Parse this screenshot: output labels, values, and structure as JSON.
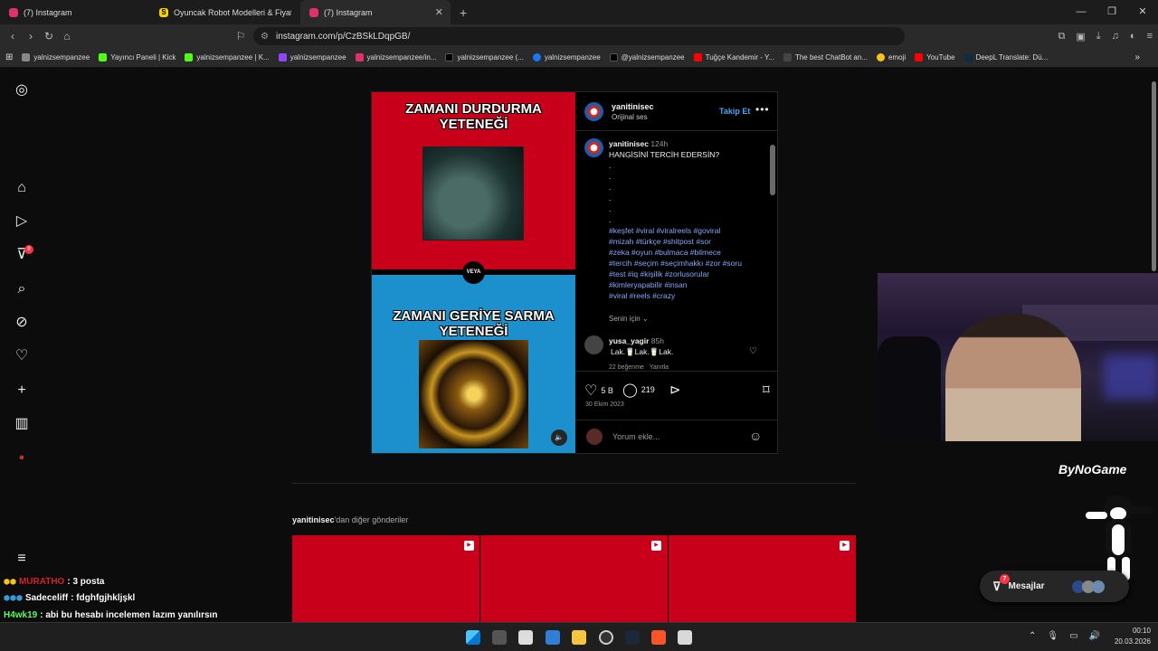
{
  "browser": {
    "tabs": [
      {
        "title": "(7) Instagram",
        "favicon_color": "#e1306c",
        "active": false
      },
      {
        "title": "Oyuncak Robot Modelleri & Fiyatları",
        "favicon_color": "#f7d600",
        "active": false
      },
      {
        "title": "(7) Instagram",
        "favicon_color": "#e1306c",
        "active": true
      }
    ],
    "url": "instagram.com/p/CzBSkLDqpGB/",
    "bookmarks": [
      {
        "label": "yalnizsempanzee",
        "color": "#888"
      },
      {
        "label": "Yayıncı Paneli | Kick",
        "color": "#53fc18"
      },
      {
        "label": "yalnizsempanzee | K...",
        "color": "#53fc18"
      },
      {
        "label": "yalnizsempanzee",
        "color": "#9146ff"
      },
      {
        "label": "yalnizsempanzee/in...",
        "color": "#e1306c"
      },
      {
        "label": "yalnizsempanzee (...",
        "color": "#000"
      },
      {
        "label": "yalnizsempanzee",
        "color": "#1877f2"
      },
      {
        "label": "@yalnizsempanzee",
        "color": "#000"
      },
      {
        "label": "Tuğçe Kandemir - Y...",
        "color": "#ff0000"
      },
      {
        "label": "The best ChatBot an...",
        "color": "#333"
      },
      {
        "label": "emoji",
        "color": "#f5c518"
      },
      {
        "label": "YouTube",
        "color": "#ff0000"
      },
      {
        "label": "DeepL Translate: Dü...",
        "color": "#0f2b46"
      }
    ]
  },
  "sidebar": {
    "notifications_badge": "8"
  },
  "post": {
    "media": {
      "top_title": "ZAMANI DURDURMA YETENEĞİ",
      "divider_label": "VEYA",
      "bottom_title": "ZAMANI GERİYE SARMA YETENEĞİ"
    },
    "author": "yanitinisec",
    "audio": "Orijinal ses",
    "follow_label": "Takip Et",
    "caption": {
      "author": "yanitinisec",
      "age": "124h",
      "text": "HANGİSİNİ TERCİH EDERSİN?",
      "dots": [
        ".",
        ".",
        ".",
        ".",
        ".",
        "."
      ],
      "hashtags": [
        "#keşfet #viral #viralreels #goviral",
        "#mizah #türkçe #shitpost #sor",
        "#zeka #oyun #bulmaca #bilmece",
        "#tercih #seçim #seçimhakkı #zor #soru",
        "#test #iq #kişilik #zorlusorular",
        "#kimleryapabilir #insan",
        "#viral #reels #crazy"
      ],
      "translation": "Senin için"
    },
    "comment": {
      "user": "yusa_yagir",
      "age": "85h",
      "text": "Lak.🥛Lak.🥛Lak.",
      "likes": "22 beğenme",
      "reply": "Yanıtla"
    },
    "likes_count": "5 B",
    "comments_count": "219",
    "date": "30 Ekim 2023",
    "comment_placeholder": "Yorum ekle..."
  },
  "more_posts": {
    "owner": "yanitinisec",
    "suffix": "'dan diğer gönderiler"
  },
  "overlay": {
    "brand": "ByNoGame",
    "messages_label": "Mesajlar",
    "messages_badge": "7",
    "chat": [
      {
        "user": "MURATHO",
        "user_color": "#d8232a",
        "message": ": 3 posta"
      },
      {
        "user": "Sadeceliff",
        "user_color": "#ffffff",
        "message": ": fdghfgjhkljşkl"
      },
      {
        "user": "H4wk19",
        "user_color": "#5cff5c",
        "message": ": abi bu hesabı incelemen lazım yanılırsın"
      }
    ]
  },
  "taskbar": {
    "time": "00:10",
    "date": "20.03.2026"
  }
}
